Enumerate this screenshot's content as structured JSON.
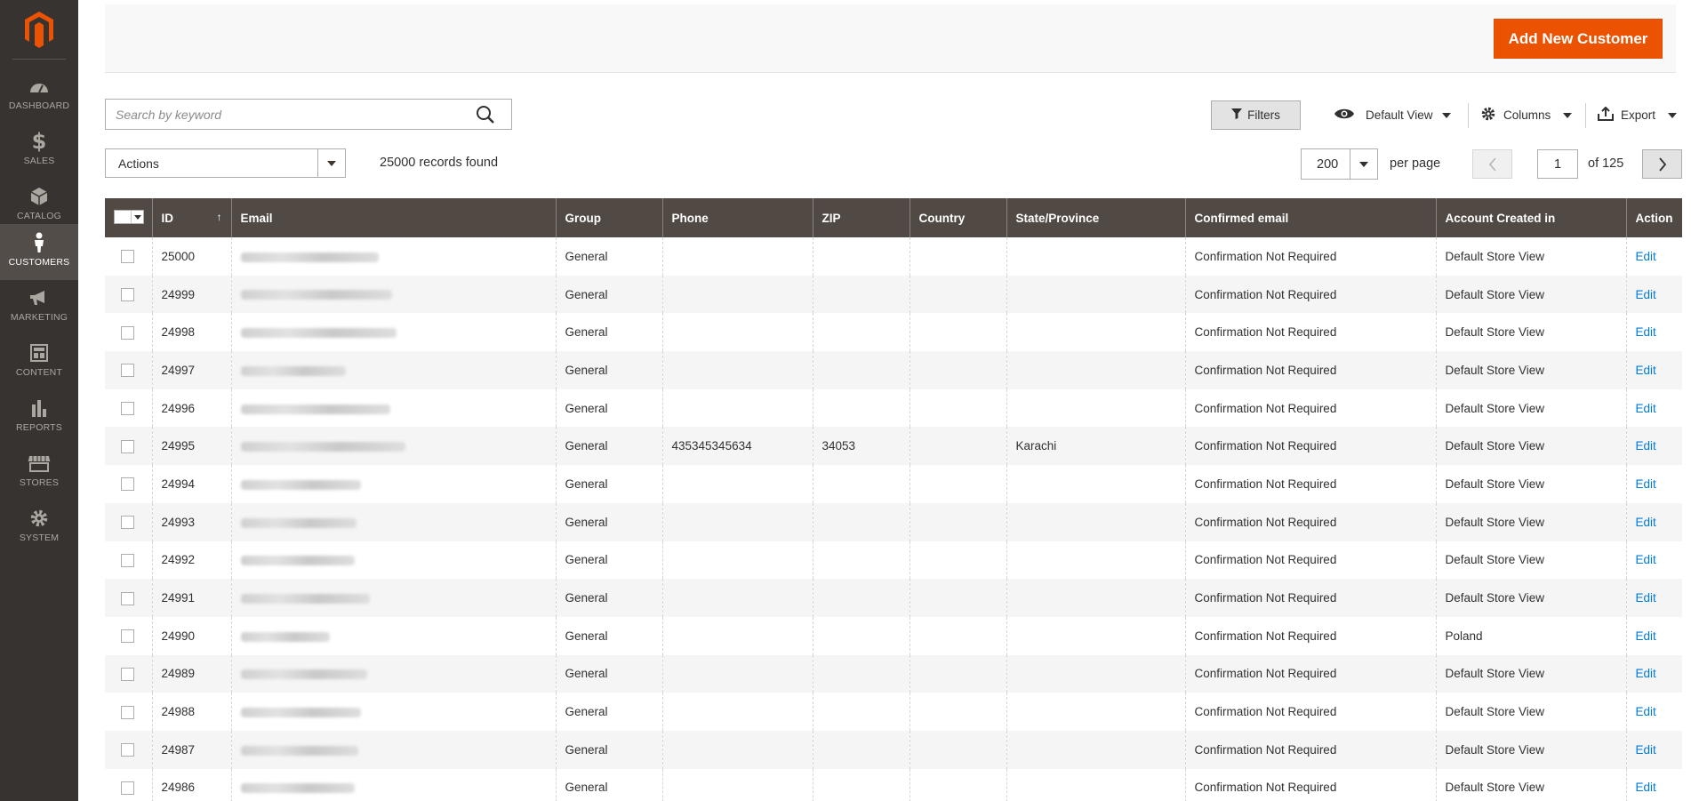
{
  "sidebar": {
    "items": [
      {
        "label": "DASHBOARD",
        "icon": "dashboard-icon",
        "active": false
      },
      {
        "label": "SALES",
        "icon": "dollar-icon",
        "active": false
      },
      {
        "label": "CATALOG",
        "icon": "cube-icon",
        "active": false
      },
      {
        "label": "CUSTOMERS",
        "icon": "person-icon",
        "active": true
      },
      {
        "label": "MARKETING",
        "icon": "megaphone-icon",
        "active": false
      },
      {
        "label": "CONTENT",
        "icon": "layout-icon",
        "active": false
      },
      {
        "label": "REPORTS",
        "icon": "bar-chart-icon",
        "active": false
      },
      {
        "label": "STORES",
        "icon": "storefront-icon",
        "active": false
      },
      {
        "label": "SYSTEM",
        "icon": "gear-icon",
        "active": false
      }
    ]
  },
  "header": {
    "add_button": "Add New Customer"
  },
  "search": {
    "placeholder": "Search by keyword",
    "value": ""
  },
  "toolbar": {
    "filters": "Filters",
    "view": "Default View",
    "columns": "Columns",
    "export": "Export"
  },
  "actions": {
    "label": "Actions"
  },
  "records_found": "25000 records found",
  "pagination": {
    "per_page_value": "200",
    "per_page_label": "per page",
    "current_page": "1",
    "of_total": "of 125"
  },
  "grid": {
    "columns": [
      "ID",
      "Email",
      "Group",
      "Phone",
      "ZIP",
      "Country",
      "State/Province",
      "Confirmed email",
      "Account Created in",
      "Action"
    ],
    "rows": [
      {
        "id": "25000",
        "group": "General",
        "phone": "",
        "zip": "",
        "country": "",
        "state": "",
        "confirmed": "Confirmation Not Required",
        "created_in": "Default Store View",
        "action": "Edit"
      },
      {
        "id": "24999",
        "group": "General",
        "phone": "",
        "zip": "",
        "country": "",
        "state": "",
        "confirmed": "Confirmation Not Required",
        "created_in": "Default Store View",
        "action": "Edit"
      },
      {
        "id": "24998",
        "group": "General",
        "phone": "",
        "zip": "",
        "country": "",
        "state": "",
        "confirmed": "Confirmation Not Required",
        "created_in": "Default Store View",
        "action": "Edit"
      },
      {
        "id": "24997",
        "group": "General",
        "phone": "",
        "zip": "",
        "country": "",
        "state": "",
        "confirmed": "Confirmation Not Required",
        "created_in": "Default Store View",
        "action": "Edit"
      },
      {
        "id": "24996",
        "group": "General",
        "phone": "",
        "zip": "",
        "country": "",
        "state": "",
        "confirmed": "Confirmation Not Required",
        "created_in": "Default Store View",
        "action": "Edit"
      },
      {
        "id": "24995",
        "group": "General",
        "phone": "435345345634",
        "zip": "34053",
        "country": "",
        "state": "Karachi",
        "confirmed": "Confirmation Not Required",
        "created_in": "Default Store View",
        "action": "Edit"
      },
      {
        "id": "24994",
        "group": "General",
        "phone": "",
        "zip": "",
        "country": "",
        "state": "",
        "confirmed": "Confirmation Not Required",
        "created_in": "Default Store View",
        "action": "Edit"
      },
      {
        "id": "24993",
        "group": "General",
        "phone": "",
        "zip": "",
        "country": "",
        "state": "",
        "confirmed": "Confirmation Not Required",
        "created_in": "Default Store View",
        "action": "Edit"
      },
      {
        "id": "24992",
        "group": "General",
        "phone": "",
        "zip": "",
        "country": "",
        "state": "",
        "confirmed": "Confirmation Not Required",
        "created_in": "Default Store View",
        "action": "Edit"
      },
      {
        "id": "24991",
        "group": "General",
        "phone": "",
        "zip": "",
        "country": "",
        "state": "",
        "confirmed": "Confirmation Not Required",
        "created_in": "Default Store View",
        "action": "Edit"
      },
      {
        "id": "24990",
        "group": "General",
        "phone": "",
        "zip": "",
        "country": "",
        "state": "",
        "confirmed": "Confirmation Not Required",
        "created_in": "Poland",
        "action": "Edit"
      },
      {
        "id": "24989",
        "group": "General",
        "phone": "",
        "zip": "",
        "country": "",
        "state": "",
        "confirmed": "Confirmation Not Required",
        "created_in": "Default Store View",
        "action": "Edit"
      },
      {
        "id": "24988",
        "group": "General",
        "phone": "",
        "zip": "",
        "country": "",
        "state": "",
        "confirmed": "Confirmation Not Required",
        "created_in": "Default Store View",
        "action": "Edit"
      },
      {
        "id": "24987",
        "group": "General",
        "phone": "",
        "zip": "",
        "country": "",
        "state": "",
        "confirmed": "Confirmation Not Required",
        "created_in": "Default Store View",
        "action": "Edit"
      },
      {
        "id": "24986",
        "group": "General",
        "phone": "",
        "zip": "",
        "country": "",
        "state": "",
        "confirmed": "Confirmation Not Required",
        "created_in": "Default Store View",
        "action": "Edit"
      }
    ]
  },
  "colors": {
    "sidebar": "#373330",
    "sidebar_active": "#524d49",
    "accent": "#eb5202",
    "header_row": "#514943",
    "link": "#007bdb"
  }
}
